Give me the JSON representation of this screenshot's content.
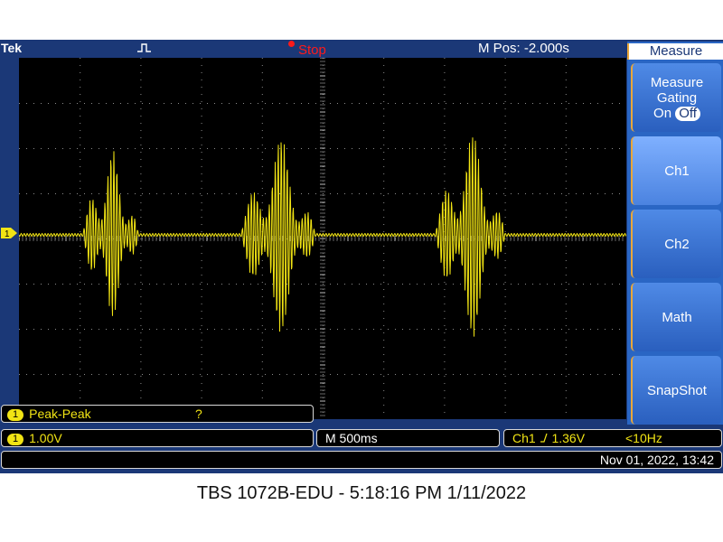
{
  "topbar": {
    "brand": "Tek",
    "run_state": "Stop",
    "horizontal_position": "M Pos: -2.000s"
  },
  "channel_marker": "1",
  "menu": {
    "title": "Measure",
    "gating_label_line1": "Measure",
    "gating_label_line2": "Gating",
    "gating_on": "On",
    "gating_off": "Off",
    "ch1": "Ch1",
    "ch2": "Ch2",
    "math": "Math",
    "snapshot": "SnapShot"
  },
  "measurement": {
    "channel": "1",
    "name": "Peak-Peak",
    "value": "?"
  },
  "status": {
    "channel": "1",
    "vertical_scale": "1.00V",
    "timebase": "M 500ms",
    "trigger_source": "Ch1",
    "trigger_level": "1.36V",
    "trigger_freq": "<10Hz",
    "datetime": "Nov 01, 2022, 13:42"
  },
  "caption": "TBS 1072B-EDU - 5:18:16 PM   1/11/2022",
  "colors": {
    "trace": "#f1e414",
    "screen": "#000000",
    "bezel": "#1b3877",
    "menu": "#2a66c4",
    "stop": "#ff1a1a"
  }
}
